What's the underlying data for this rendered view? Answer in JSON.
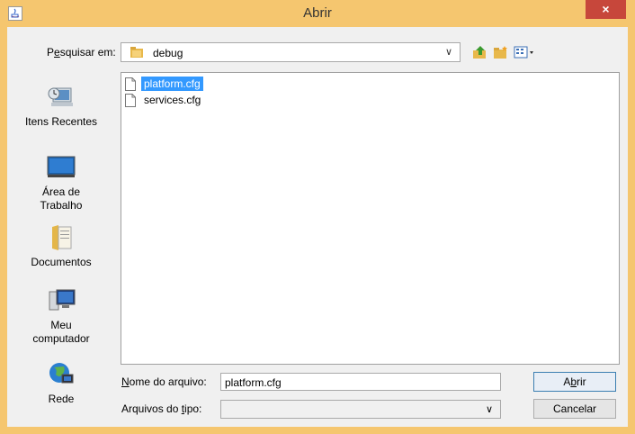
{
  "window": {
    "title": "Abrir",
    "close": "×"
  },
  "lookin": {
    "label_pre": "P",
    "label_u": "e",
    "label_post": "squisar em:",
    "value": "debug"
  },
  "sidebar": [
    {
      "key": "recent",
      "label": "Itens Recentes",
      "icon": "recent-items-icon"
    },
    {
      "key": "desktop",
      "label1": "Área de",
      "label2": "Trabalho",
      "icon": "desktop-icon"
    },
    {
      "key": "documents",
      "label": "Documentos",
      "icon": "documents-icon"
    },
    {
      "key": "computer",
      "label1": "Meu",
      "label2": "computador",
      "icon": "computer-icon"
    },
    {
      "key": "network",
      "label": "Rede",
      "icon": "network-icon"
    }
  ],
  "files": [
    {
      "name": "platform.cfg",
      "selected": true
    },
    {
      "name": "services.cfg",
      "selected": false
    }
  ],
  "filename": {
    "label_u": "N",
    "label_post": "ome do arquivo:",
    "value": "platform.cfg"
  },
  "filetype": {
    "label_pre": "Arquivos do ",
    "label_u": "t",
    "label_post": "ipo:",
    "value": ""
  },
  "buttons": {
    "open_pre": "A",
    "open_u": "b",
    "open_post": "rir",
    "cancel": "Cancelar"
  },
  "colors": {
    "frame": "#f5c66f",
    "close": "#c7473b",
    "selection": "#3399ff"
  }
}
